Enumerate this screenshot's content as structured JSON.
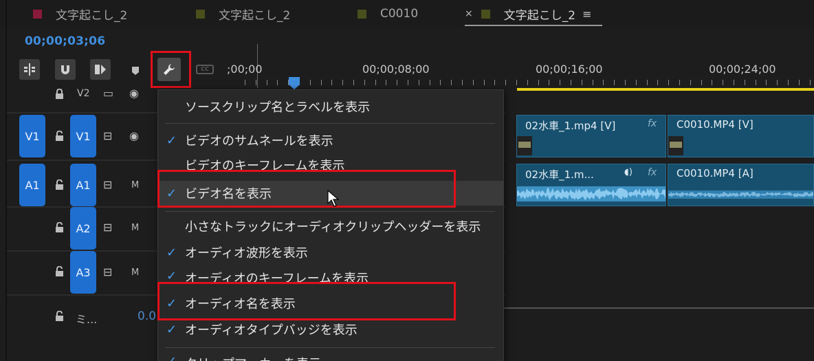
{
  "tabs": [
    {
      "label": "文字起こし_2",
      "color": "#8a1a3a"
    },
    {
      "label": "文字起こし_2",
      "color": "#4a4f1c"
    },
    {
      "label": "C0010",
      "color": "#4a4f1c"
    },
    {
      "label": "文字起こし_2",
      "color": "#4a4f1c",
      "close": "×",
      "menu": "≡"
    }
  ],
  "timecode": "00;00;03;06",
  "toolbar": {
    "snap_icon": "insert-snap-icon",
    "magnet_icon": "magnet-icon",
    "linked_icon": "linked-selection-icon",
    "marker_icon": "marker-icon",
    "settings_icon": "wrench-icon",
    "cc_label": "CC"
  },
  "ruler": {
    "labels": [
      ";00;00",
      "00;00;08;00",
      "00;00;16;00",
      "00;00;24;00"
    ]
  },
  "tracks": {
    "v2": {
      "label": "V2"
    },
    "v1": {
      "source": "V1",
      "target": "V1"
    },
    "a1": {
      "source": "A1",
      "target": "A1",
      "mute": "M"
    },
    "a2": {
      "target": "A2",
      "mute": "M"
    },
    "a3": {
      "target": "A3",
      "mute": "M"
    },
    "mix": {
      "label": "ミ...",
      "value": "0.0"
    }
  },
  "clips": {
    "v1_a": {
      "name": "02水車_1.mp4 [V]",
      "fx": "fx"
    },
    "v1_b": {
      "name": "C0010.MP4 [V]"
    },
    "a1_a": {
      "name": "02水車_1.m...",
      "fx": "fx"
    },
    "a1_b": {
      "name": "C0010.MP4 [A]"
    }
  },
  "menu": {
    "items": [
      {
        "label": "ソースクリップ名とラベルを表示",
        "checked": false
      },
      {
        "label": "ビデオのサムネールを表示",
        "checked": true
      },
      {
        "label": "ビデオのキーフレームを表示",
        "checked": false
      },
      {
        "label": "ビデオ名を表示",
        "checked": true
      },
      {
        "label": "小さなトラックにオーディオクリップヘッダーを表示",
        "checked": false
      },
      {
        "label": "オーディオ波形を表示",
        "checked": true
      },
      {
        "label": "オーディオのキーフレームを表示",
        "checked": true
      },
      {
        "label": "オーディオ名を表示",
        "checked": true
      },
      {
        "label": "オーディオタイプバッジを表示",
        "checked": true
      },
      {
        "label": "クリップマーカーを表示",
        "checked": true
      }
    ],
    "check_glyph": "✓"
  },
  "colors": {
    "accent_blue": "#1f6fd1",
    "timecode_blue": "#3f8ede",
    "highlight_red": "#e0101a",
    "clip_teal": "#17506e",
    "work_area_yellow": "#e6d21c"
  }
}
